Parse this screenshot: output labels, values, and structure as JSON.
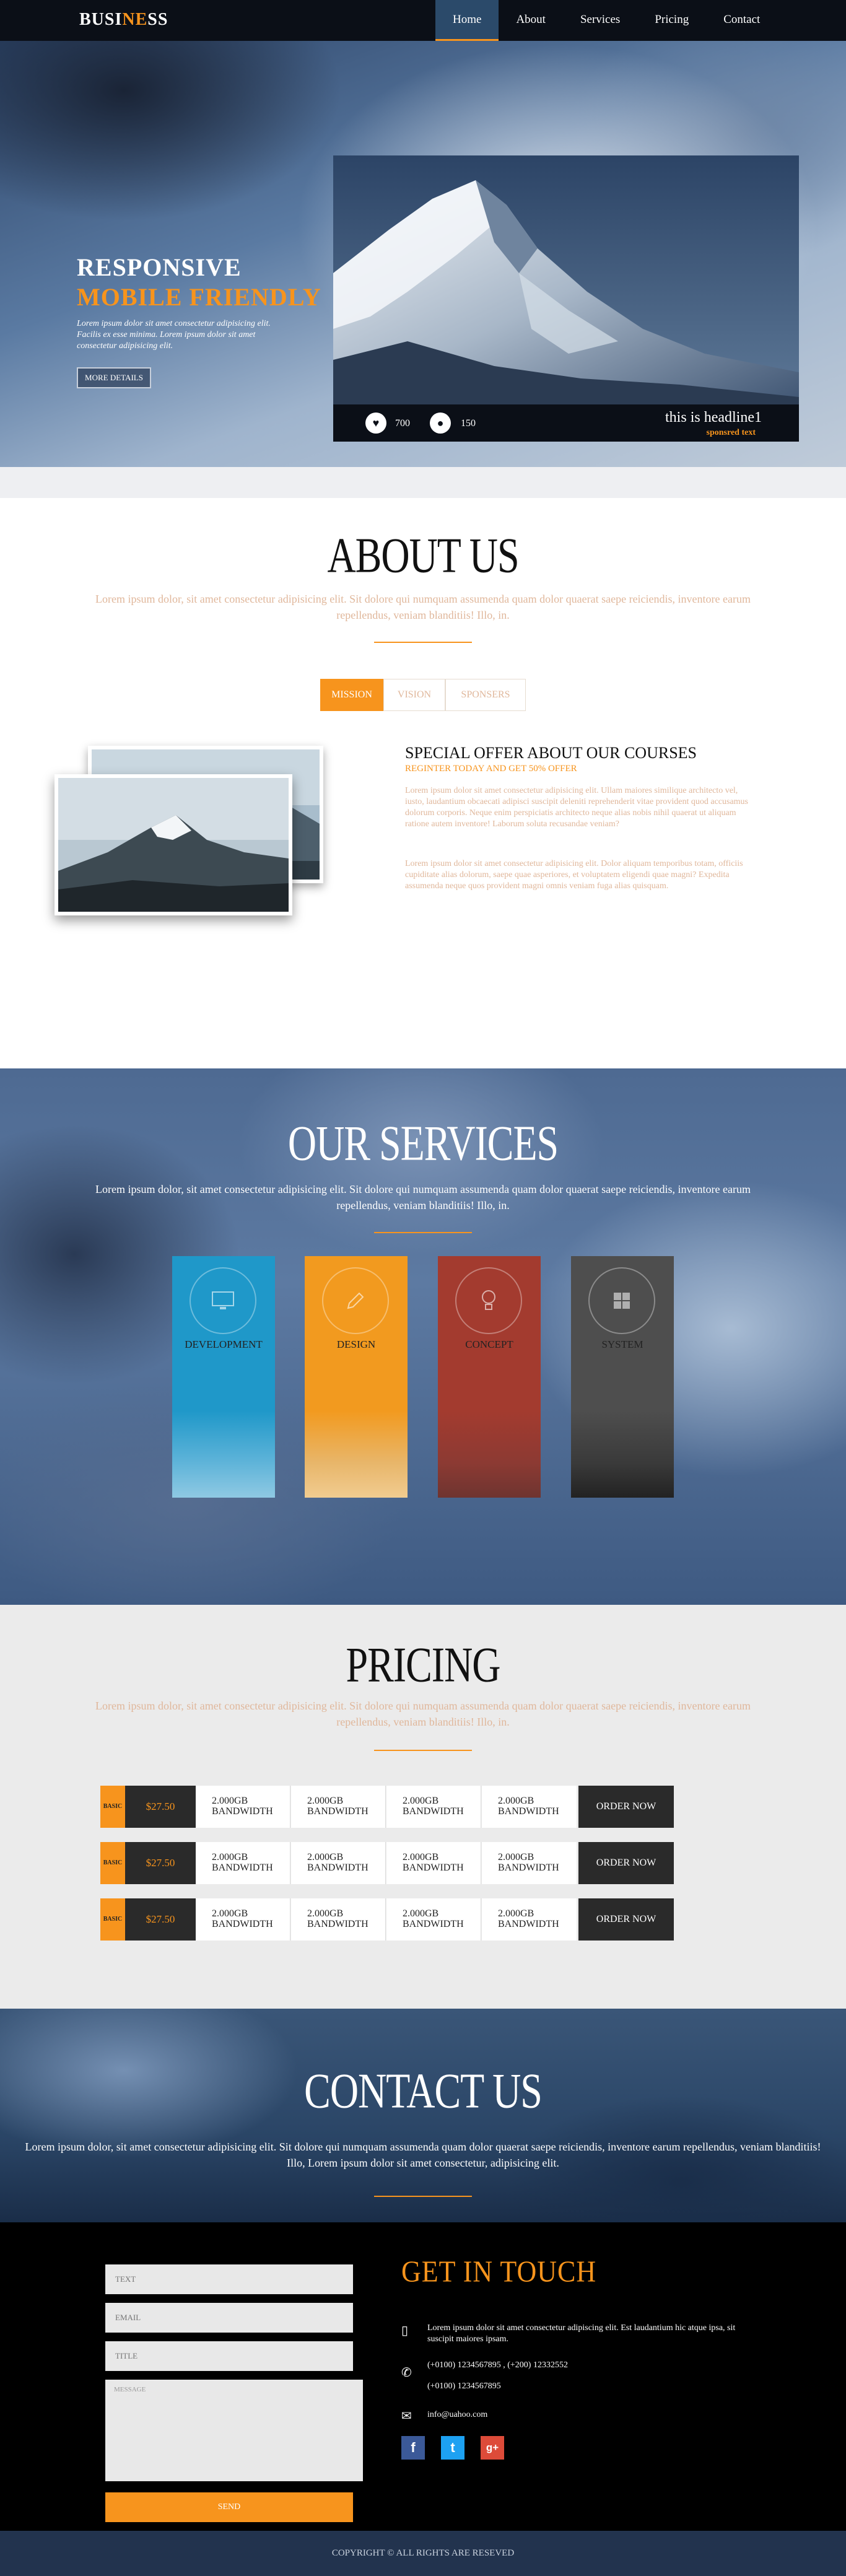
{
  "colors": {
    "accent": "#f7941d",
    "nav_bg": "#0b0f17",
    "nav_active": "#2b4a6a",
    "footer_bg": "#000000",
    "copyright_bg": "#22334e"
  },
  "brand": {
    "part1": "BUSI",
    "part2": "NE",
    "part3": "SS"
  },
  "nav": {
    "items": [
      "Home",
      "About",
      "Services",
      "Pricing",
      "Contact"
    ],
    "active": "Home"
  },
  "hero": {
    "title_line1": "RESPONSIVE",
    "title_line2": "MOBILE FRIENDLY",
    "text": "Lorem ipsum dolor sit amet consectetur adipisicing elit. Facilis ex esse minima. Lorem ipsum dolor sit amet consectetur adipisicing elit.",
    "button": "MORE DETAILS",
    "likes": "700",
    "comments": "150",
    "headline": "this is headline1",
    "subtext": "sponsred text",
    "like_icon": "heart-icon",
    "comment_icon": "comment-icon"
  },
  "about": {
    "title": "ABOUT US",
    "text": "Lorem ipsum dolor, sit amet consectetur adipisicing elit. Sit dolore qui numquam assumenda quam dolor quaerat saepe reiciendis, inventore earum repellendus, veniam blanditiis! Illo, in.",
    "tabs": [
      "MISSION",
      "VISION",
      "SPONSERS"
    ],
    "active_tab": "MISSION",
    "offer_title": "SPECIAL OFFER ABOUT OUR COURSES",
    "offer_sub": "REGINTER TODAY AND GET 50% OFFER",
    "offer_p1": "Lorem ipsum dolor sit amet consectetur adipisicing elit. Ullam maiores similique architecto vel, iusto, laudantium obcaecati adipisci suscipit deleniti reprehenderit vitae provident quod accusamus dolorum corporis. Neque enim perspiciatis architecto neque alias nobis nihil quaerat ut aliquam ratione autem inventore! Laborum soluta recusandae veniam?",
    "offer_p2": "Lorem ipsum dolor sit amet consectetur adipisicing elit. Dolor aliquam temporibus totam, officiis cupiditate alias dolorum, saepe quae asperiores, et voluptatem eligendi quae magni? Expedita assumenda neque quos provident magni omnis veniam fuga alias quisquam."
  },
  "services": {
    "title": "OUR SERVICES",
    "text": "Lorem ipsum dolor, sit amet consectetur adipisicing elit. Sit dolore qui numquam assumenda quam dolor quaerat saepe reiciendis, inventore earum repellendus, veniam blanditiis! Illo, in.",
    "cards": [
      {
        "label": "DEVELOPMENT",
        "icon": "monitor-icon",
        "color": "#1f98c9"
      },
      {
        "label": "DESIGN",
        "icon": "pencil-icon",
        "color": "#f29a1f"
      },
      {
        "label": "CONCEPT",
        "icon": "lightbulb-icon",
        "color": "#a33b2f"
      },
      {
        "label": "SYSTEM",
        "icon": "windows-icon",
        "color": "#4e4e4e"
      }
    ]
  },
  "pricing": {
    "title": "PRICING",
    "text": "Lorem ipsum dolor, sit amet consectetur adipisicing elit. Sit dolore qui numquam assumenda quam dolor quaerat saepe reiciendis, inventore earum repellendus, veniam blanditiis! Illo, in.",
    "rows": [
      {
        "tier": "BASIC",
        "price": "$27.50",
        "cells": [
          "2.000GB BANDWIDTH",
          "2.000GB BANDWIDTH",
          "2.000GB BANDWIDTH",
          "2.000GB BANDWIDTH"
        ],
        "button": "ORDER NOW"
      },
      {
        "tier": "BASIC",
        "price": "$27.50",
        "cells": [
          "2.000GB BANDWIDTH",
          "2.000GB BANDWIDTH",
          "2.000GB BANDWIDTH",
          "2.000GB BANDWIDTH"
        ],
        "button": "ORDER NOW"
      },
      {
        "tier": "BASIC",
        "price": "$27.50",
        "cells": [
          "2.000GB BANDWIDTH",
          "2.000GB BANDWIDTH",
          "2.000GB BANDWIDTH",
          "2.000GB BANDWIDTH"
        ],
        "button": "ORDER NOW"
      }
    ]
  },
  "contact": {
    "title": "CONTACT US",
    "text": "Lorem ipsum dolor, sit amet consectetur adipisicing elit. Sit dolore qui numquam assumenda quam dolor quaerat saepe reiciendis, inventore earum repellendus, veniam blanditiis! Illo, Lorem ipsum dolor sit amet consectetur, adipisicing elit."
  },
  "form": {
    "text_placeholder": "TEXT",
    "email_placeholder": "EMAIL",
    "title_placeholder": "TITLE",
    "message_placeholder": "MESSAGE",
    "send": "SEND"
  },
  "get_in_touch": {
    "title": "GET IN TOUCH",
    "address": "Lorem ipsum dolor sit amet consectetur adipiscing elit. Est laudantium hic atque ipsa, sit suscipit maiores ipsam.",
    "phone1": "(+0100) 1234567895 , (+200) 12332552",
    "phone2": "(+0100) 1234567895",
    "email": "info@uahoo.com",
    "address_icon": "map-icon",
    "phone_icon": "phone-icon",
    "email_icon": "envelope-icon",
    "social": [
      {
        "icon": "facebook-icon",
        "glyph": "f",
        "color": "#3b5998"
      },
      {
        "icon": "twitter-icon",
        "glyph": "t",
        "color": "#1da1f2"
      },
      {
        "icon": "google-plus-icon",
        "glyph": "g+",
        "color": "#dd4b39"
      }
    ]
  },
  "copyright": "COPYRIGHT © ALL RIGHTS ARE RESEVED"
}
